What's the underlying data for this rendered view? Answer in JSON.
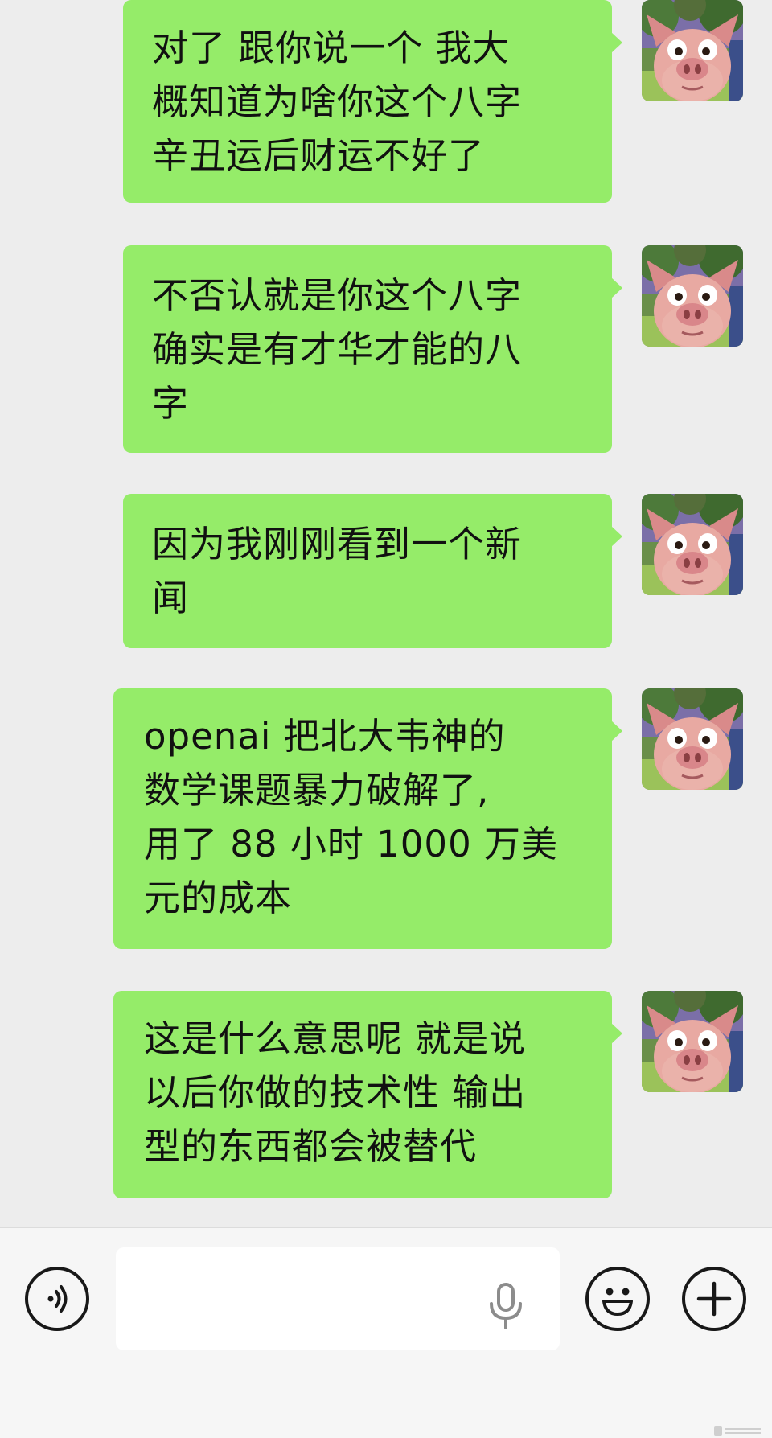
{
  "chat": {
    "messages": [
      {
        "text": "对了 跟你说一个 我大\n概知道为啥你这个八字\n辛丑运后财运不好了",
        "avatar_icon": "pig-avatar-icon"
      },
      {
        "text": "不否认就是你这个八字\n确实是有才华才能的八\n字",
        "avatar_icon": "pig-avatar-icon"
      },
      {
        "text": "因为我刚刚看到一个新\n闻",
        "avatar_icon": "pig-avatar-icon"
      },
      {
        "text": "openai 把北大韦神的\n数学课题暴力破解了,\n用了 88 小时 1000 万美\n元的成本",
        "avatar_icon": "pig-avatar-icon"
      },
      {
        "text": "这是什么意思呢 就是说\n以后你做的技术性 输出\n型的东西都会被替代",
        "avatar_icon": "pig-avatar-icon"
      }
    ],
    "bubble_color": "#95ec69",
    "background_color": "#ededed"
  },
  "input_bar": {
    "voice_icon": "voice-mode-icon",
    "input_value": "",
    "mic_icon": "microphone-icon",
    "emoji_icon": "emoji-icon",
    "plus_icon": "plus-icon",
    "background_color": "#f6f6f6"
  }
}
